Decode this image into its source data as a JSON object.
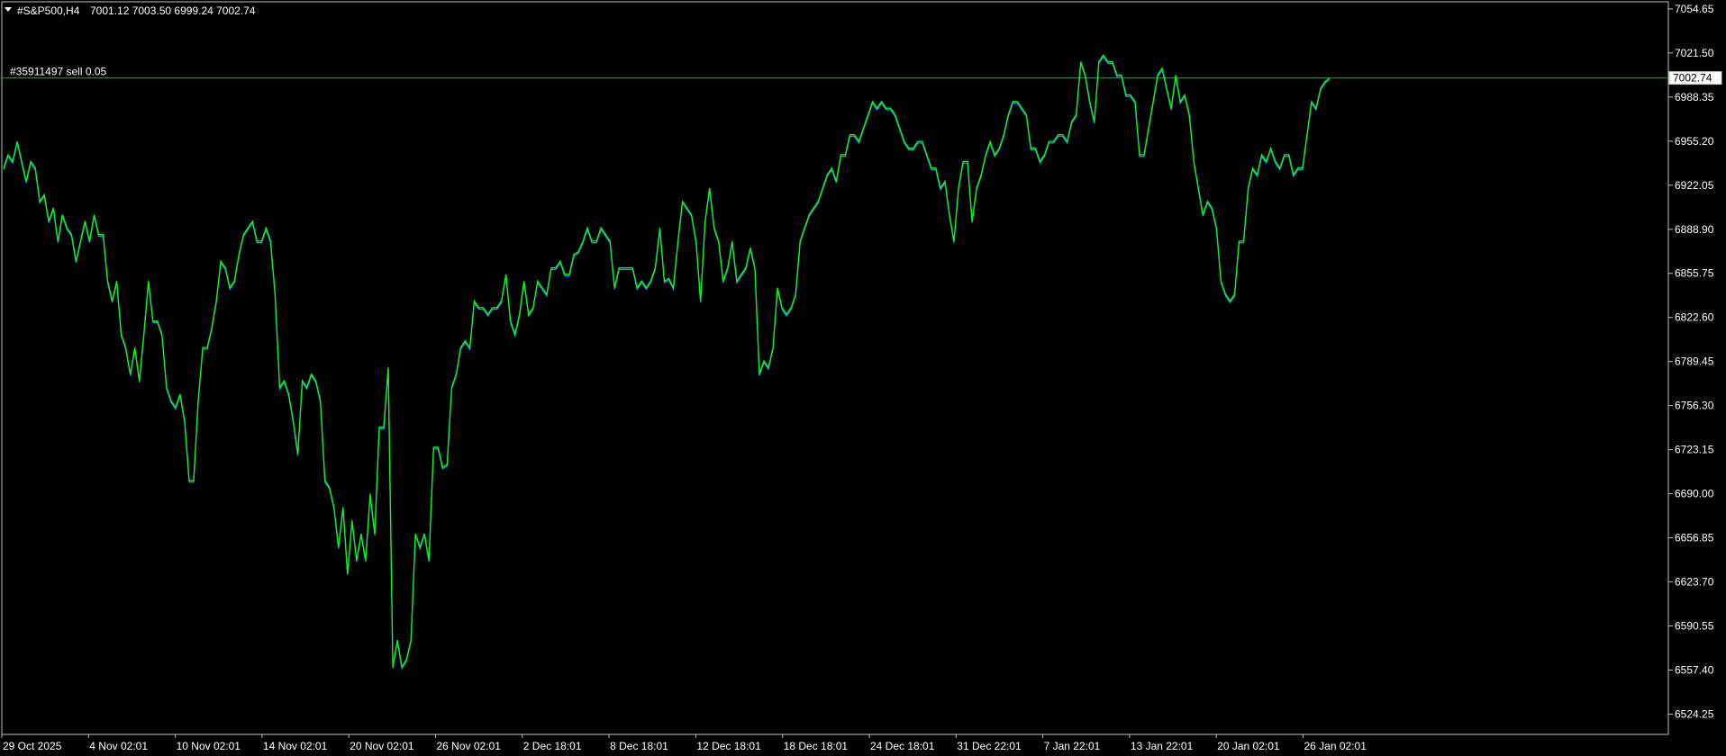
{
  "header": {
    "symbol": "#S&P500,H4",
    "ohlc": "7001.12 7003.50 6999.24 7002.74"
  },
  "order_line": {
    "label": "#35911497 sell 0.05",
    "price": 7002.74
  },
  "current_price_label": "7002.74",
  "colors": {
    "background": "#000000",
    "frame": "#c0c0c0",
    "bid_line": "#00ff00",
    "ask_line": "#1e90ff",
    "order_line": "#2e8b57",
    "text": "#ffffff"
  },
  "chart_data": {
    "type": "line",
    "ylim": [
      6509.0,
      7060.0
    ],
    "y_ticks": [
      "7054.65",
      "7021.50",
      "6988.35",
      "6955.20",
      "6922.05",
      "6888.90",
      "6855.75",
      "6822.60",
      "6789.45",
      "6756.30",
      "6723.15",
      "6690.00",
      "6656.85",
      "6623.70",
      "6590.55",
      "6557.40",
      "6524.25"
    ],
    "x_ticks": [
      "29 Oct 2025",
      "4 Nov 02:01",
      "10 Nov 02:01",
      "14 Nov 02:01",
      "20 Nov 02:01",
      "26 Nov 02:01",
      "2 Dec 18:01",
      "8 Dec 18:01",
      "12 Dec 18:01",
      "18 Dec 18:01",
      "24 Dec 18:01",
      "31 Dec 22:01",
      "7 Jan 22:01",
      "13 Jan 22:01",
      "20 Jan 02:01",
      "26 Jan 02:01"
    ],
    "series": [
      {
        "role": "bid",
        "values": [
          6935,
          6945,
          6940,
          6955,
          6940,
          6925,
          6940,
          6935,
          6910,
          6915,
          6895,
          6905,
          6880,
          6900,
          6890,
          6885,
          6865,
          6880,
          6895,
          6880,
          6900,
          6885,
          6885,
          6850,
          6835,
          6850,
          6810,
          6800,
          6780,
          6800,
          6775,
          6810,
          6850,
          6820,
          6820,
          6810,
          6770,
          6760,
          6755,
          6765,
          6745,
          6700,
          6700,
          6760,
          6800,
          6800,
          6815,
          6835,
          6865,
          6860,
          6845,
          6850,
          6870,
          6885,
          6890,
          6895,
          6880,
          6880,
          6890,
          6880,
          6840,
          6770,
          6775,
          6765,
          6745,
          6720,
          6775,
          6770,
          6780,
          6775,
          6760,
          6700,
          6695,
          6680,
          6650,
          6680,
          6630,
          6670,
          6640,
          6660,
          6640,
          6690,
          6660,
          6740,
          6740,
          6785,
          6560,
          6580,
          6560,
          6565,
          6580,
          6660,
          6650,
          6660,
          6640,
          6725,
          6725,
          6710,
          6712,
          6770,
          6780,
          6800,
          6805,
          6800,
          6835,
          6830,
          6830,
          6825,
          6830,
          6830,
          6835,
          6855,
          6820,
          6810,
          6825,
          6850,
          6825,
          6830,
          6850,
          6845,
          6840,
          6860,
          6860,
          6865,
          6855,
          6855,
          6870,
          6872,
          6880,
          6890,
          6880,
          6880,
          6890,
          6885,
          6880,
          6845,
          6860,
          6860,
          6860,
          6860,
          6845,
          6850,
          6845,
          6850,
          6860,
          6890,
          6850,
          6852,
          6845,
          6880,
          6910,
          6905,
          6900,
          6880,
          6835,
          6895,
          6920,
          6890,
          6880,
          6850,
          6860,
          6880,
          6850,
          6855,
          6860,
          6875,
          6860,
          6780,
          6790,
          6785,
          6800,
          6845,
          6830,
          6825,
          6830,
          6840,
          6880,
          6890,
          6900,
          6905,
          6910,
          6920,
          6930,
          6935,
          6925,
          6945,
          6945,
          6960,
          6960,
          6955,
          6965,
          6975,
          6985,
          6980,
          6985,
          6980,
          6980,
          6975,
          6965,
          6955,
          6950,
          6950,
          6955,
          6955,
          6945,
          6935,
          6935,
          6920,
          6925,
          6900,
          6880,
          6920,
          6940,
          6940,
          6895,
          6920,
          6930,
          6945,
          6955,
          6945,
          6950,
          6960,
          6975,
          6985,
          6985,
          6980,
          6975,
          6950,
          6950,
          6940,
          6945,
          6955,
          6955,
          6960,
          6960,
          6955,
          6970,
          6975,
          7015,
          7005,
          6985,
          6970,
          7015,
          7020,
          7015,
          7015,
          7005,
          7005,
          6990,
          6990,
          6985,
          6945,
          6945,
          6965,
          6985,
          7005,
          7010,
          6995,
          6980,
          7005,
          6985,
          6990,
          6975,
          6940,
          6920,
          6900,
          6910,
          6905,
          6890,
          6850,
          6840,
          6835,
          6840,
          6880,
          6880,
          6920,
          6935,
          6930,
          6945,
          6940,
          6950,
          6940,
          6935,
          6945,
          6945,
          6930,
          6935,
          6935,
          6960,
          6985,
          6980,
          6995,
          7000,
          7002.74
        ]
      }
    ]
  }
}
